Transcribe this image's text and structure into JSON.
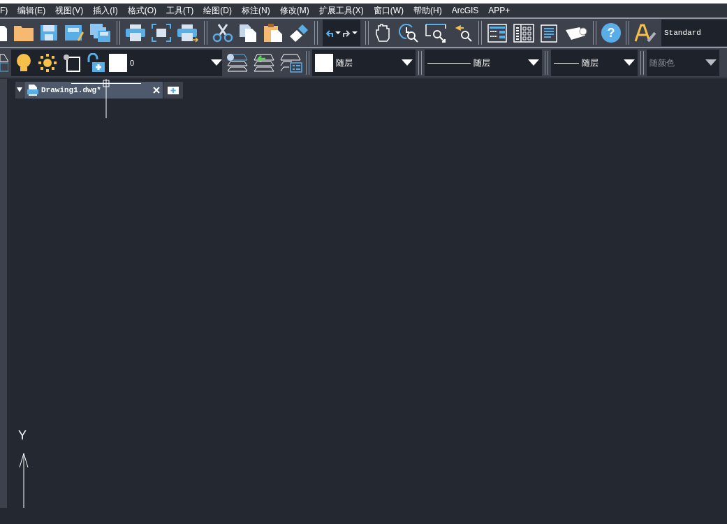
{
  "menu": [
    {
      "label": "F)"
    },
    {
      "label": "编辑(E)"
    },
    {
      "label": "视图(V)"
    },
    {
      "label": "插入(I)"
    },
    {
      "label": "格式(O)"
    },
    {
      "label": "工具(T)"
    },
    {
      "label": "绘图(D)"
    },
    {
      "label": "标注(N)"
    },
    {
      "label": "修改(M)"
    },
    {
      "label": "扩展工具(X)"
    },
    {
      "label": "窗口(W)"
    },
    {
      "label": "帮助(H)"
    },
    {
      "label": "ArcGIS"
    },
    {
      "label": "APP+"
    }
  ],
  "help": {
    "glyph": "?"
  },
  "text_style": {
    "value": "Standard"
  },
  "layer": {
    "value": "0"
  },
  "properties": [
    {
      "kind": "color",
      "value": "随层",
      "disabled": false
    },
    {
      "kind": "linetype",
      "value": "随层",
      "disabled": false
    },
    {
      "kind": "lineweight",
      "value": "随层",
      "disabled": false
    },
    {
      "kind": "plotstyle",
      "value": "随颜色",
      "disabled": true
    }
  ],
  "tabs": [
    {
      "label": "Drawing1.dwg*",
      "selected": true
    }
  ],
  "canvas": {
    "axis_label": "Y"
  }
}
